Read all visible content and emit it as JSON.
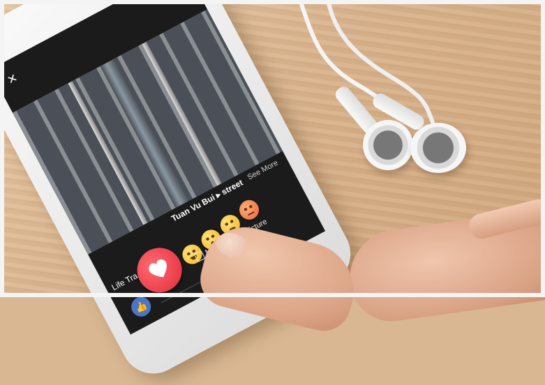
{
  "screen": {
    "close_glyph": "×",
    "caption_user": "Tuan Vu Bui ▸ street",
    "see_more": "See More",
    "caption_life": "Life Tra",
    "make_profile_picture": "Make Profile Picture"
  },
  "reactions": [
    {
      "name": "like",
      "icon": "thumbs-up-icon",
      "color": "#4a76c8"
    },
    {
      "name": "love",
      "icon": "heart-icon",
      "color": "#e02a3b"
    },
    {
      "name": "haha",
      "icon": "laughing-face-icon",
      "color": "#f3b524"
    },
    {
      "name": "wow",
      "icon": "surprised-face-icon",
      "color": "#f3b524"
    },
    {
      "name": "sad",
      "icon": "sad-face-icon",
      "color": "#f3b524"
    },
    {
      "name": "angry",
      "icon": "angry-face-icon",
      "color": "#e8613a"
    }
  ],
  "colors": {
    "table_wood": "#d8b38d",
    "phone_body": "#f2f2f2",
    "screen_bg": "#1b1b1b"
  }
}
